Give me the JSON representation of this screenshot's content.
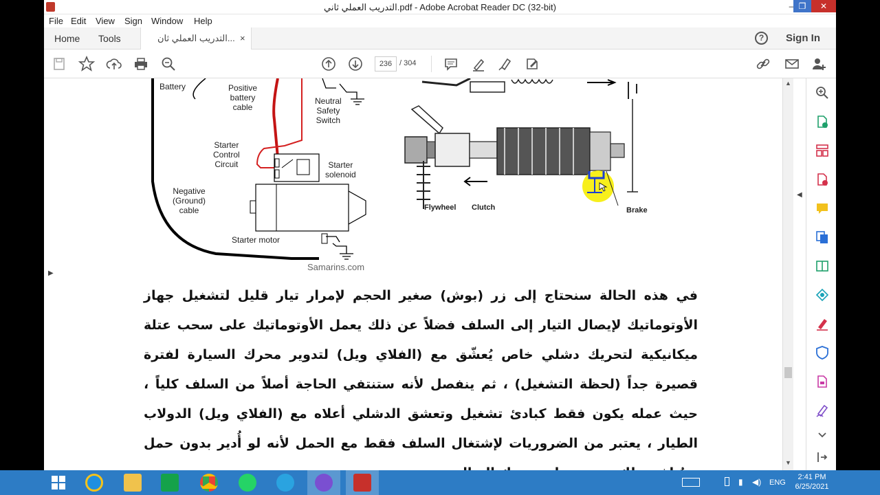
{
  "window": {
    "title": "التدريب العملي ثاني.pdf - Adobe Acrobat Reader DC (32-bit)",
    "minimize": "‒",
    "maximize": "❐",
    "close": "✕"
  },
  "menu": [
    "File",
    "Edit",
    "View",
    "Sign",
    "Window",
    "Help"
  ],
  "tabs": {
    "home": "Home",
    "tools": "Tools",
    "document": "التدريب العملي ثان...",
    "close": "×",
    "help": "?",
    "sign_in": "Sign In"
  },
  "toolbar": {
    "page_current": "236",
    "page_total": "/  304"
  },
  "figure": {
    "labels": {
      "battery": "Battery",
      "positive_cable": "Positive\nbattery\ncable",
      "neutral_switch": "Neutral\nSafety\nSwitch",
      "starter_control": "Starter\nControl\nCircuit",
      "starter_solenoid": "Starter\nsolenoid",
      "negative_cable": "Negative\n(Ground)\ncable",
      "starter_motor": "Starter motor",
      "flywheel": "Flywheel",
      "clutch": "Clutch",
      "brake": "Brake"
    },
    "watermark": "Samarins.com"
  },
  "body_text": "في هذه الحالة سنحتاج إلى زر (بوش) صغير الحجم لإمرار تيار قليل لتشغيل جهاز الأوتوماتيك لإيصال التيار إلى السلف فضلاً عن ذلك يعمل الأوتوماتيك على سحب عتلة ميكانيكية لتحريك دشلي خاص يُعشّق مع (الفلاي ويل) لتدوير محرك السيارة لفترة قصيرة جداً (لحظة التشغيل) ، ثم ينفصل لأنه ستنتفي الحاجة أصلاً من السلف كلياً ، حيث عمله يكون فقط كبادئ تشغيل وتعشق الدشلي أعلاه مع (الفلاي ويل) الدولاب الطيار ، يعتبر من الضروريات لإشتغال السلف فقط مع الحمل لأنه لو أُدير بدون حمل سيُتلف وتلك من مميزات محرك التوالي.",
  "taskbar": {
    "language": "ENG",
    "time": "2:41 PM",
    "date": "6/25/2021"
  },
  "colors": {
    "taskbar": "#2d7cc5",
    "accent_red": "#c7302b",
    "highlight_yellow": "#f7ef1c"
  }
}
